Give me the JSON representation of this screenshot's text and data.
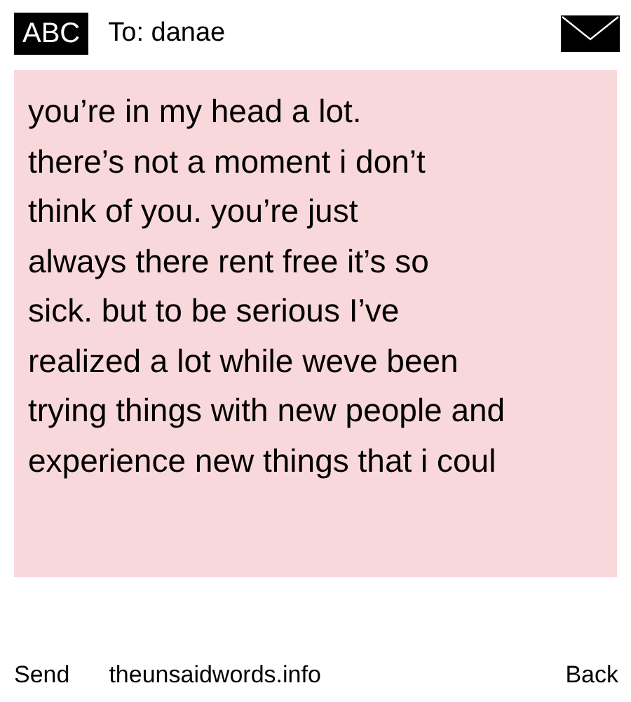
{
  "header": {
    "input_mode": "ABC",
    "recipient": "To: danae"
  },
  "message": {
    "lines": [
      "you’re in my head a lot.",
      "there’s not a moment i don’t",
      "think of you. you’re just",
      "always there rent free it’s so",
      "sick. but to be serious I’ve",
      "realized a lot while weve been",
      "trying things with new people and",
      "experience new things that i coul"
    ]
  },
  "soft_keys": {
    "left": "Send",
    "middle": "theunsaidwords.info",
    "right": "Back"
  }
}
